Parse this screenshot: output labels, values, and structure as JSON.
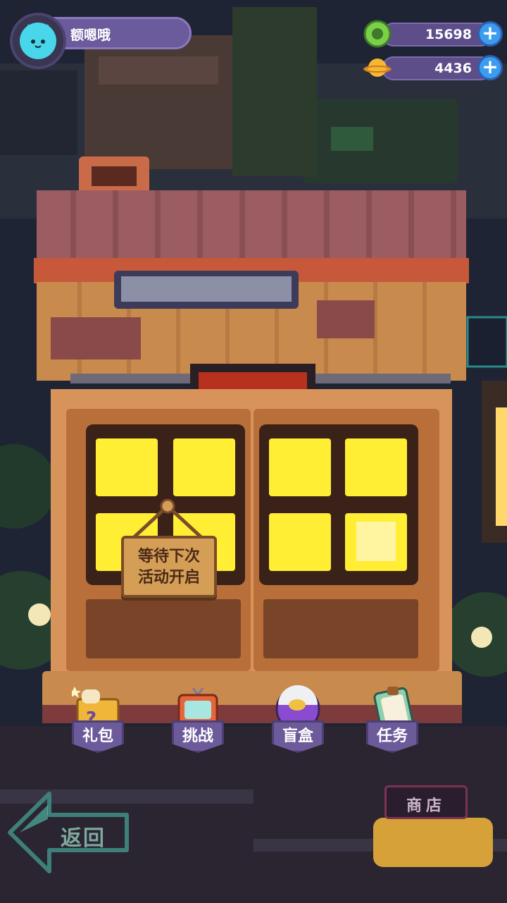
{
  "player": {
    "name": "额嗯哦",
    "avatar_icon": "cat-avatar-icon"
  },
  "currencies": [
    {
      "icon": "green-coin-icon",
      "value": "15698",
      "color": "#7bd04a"
    },
    {
      "icon": "planet-coin-icon",
      "value": "4436",
      "color": "#f7b733"
    }
  ],
  "sign": {
    "line1": "等待下次",
    "line2": "活动开启"
  },
  "menu": [
    {
      "label": "礼包",
      "icon": "gift-box-icon"
    },
    {
      "label": "挑战",
      "icon": "tv-challenge-icon"
    },
    {
      "label": "盲盒",
      "icon": "blind-box-ball-icon"
    },
    {
      "label": "任务",
      "icon": "clipboard-task-icon"
    }
  ],
  "back": {
    "label": "返回"
  },
  "shop": {
    "label": "商店"
  },
  "colors": {
    "window_glow": "#ffee33",
    "wood": "#c98a4e",
    "roof": "#9b5c62",
    "accent_purple": "#6c5a9a"
  }
}
